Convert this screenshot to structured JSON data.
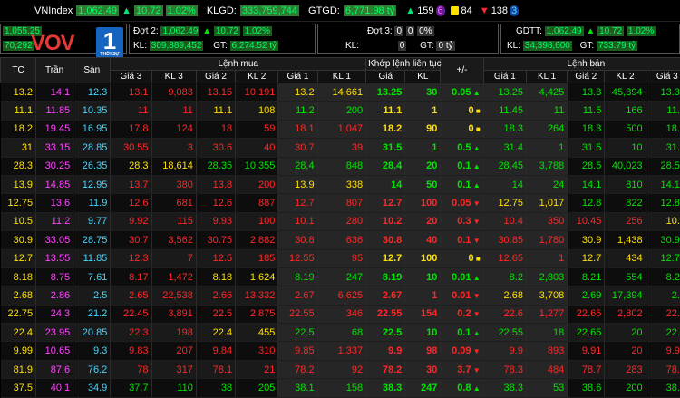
{
  "topbar": {
    "index_name": "VNIndex",
    "index_value": "1,062.49",
    "index_change": "10.72",
    "index_pct": "1.02%",
    "klgd_label": "KLGD:",
    "klgd_value": "333,759,744",
    "gtgd_label": "GTGD:",
    "gtgd_value": "6,771.98 tỷ",
    "up_count": "159",
    "up_ceiling": "6",
    "ref_count": "84",
    "down_count": "138",
    "down_floor": "3"
  },
  "boxes": {
    "left_r1": "1,055.25",
    "left_r2": "70,292",
    "b1_r1_label": "Đợt 2:",
    "b1_r1_value": "1,062.49",
    "b1_r1_change": "10.72",
    "b1_r1_pct": "1.02%",
    "b1_r2_kl_label": "KL:",
    "b1_r2_kl_value": "309,889,452",
    "b1_r2_gt_label": "GT:",
    "b1_r2_gt_value": "6,274.52 tỷ",
    "b2_r1_label": "Đợt 3:",
    "b2_r1_value": "0",
    "b2_r1_change": "0",
    "b2_r1_pct": "0%",
    "b2_r2_kl_label": "KL:",
    "b2_r2_kl_value": "0",
    "b2_r2_gt_label": "GT:",
    "b2_r2_gt_value": "0 tỷ",
    "b3_r1_label": "GDTT:",
    "b3_r1_value": "1,062.49",
    "b3_r1_change": "10.72",
    "b3_r1_pct": "1.02%",
    "b3_r2_kl_label": "KL:",
    "b3_r2_kl_value": "34,398,600",
    "b3_r2_gt_label": "GT:",
    "b3_r2_gt_value": "733.79 tỷ"
  },
  "logo": {
    "brand": "VOV",
    "channel": "1",
    "tagline": "THỜI SỰ"
  },
  "headers": {
    "tc": "TC",
    "tran": "Trần",
    "san": "Sàn",
    "lenh_mua": "Lệnh mua",
    "khop_lenh": "Khớp lệnh liên tục",
    "plusminus": "+/-",
    "lenh_ban": "Lệnh bán",
    "gia3": "Giá 3",
    "kl3": "KL 3",
    "gia2": "Giá 2",
    "kl2": "KL 2",
    "gia1": "Giá 1",
    "kl1": "KL 1",
    "gia": "Giá",
    "kl": "KL",
    "sgia1": "Giá 1",
    "skl1": "KL 1",
    "sgia2": "Giá 2",
    "skl2": "KL 2",
    "sgia3": "Giá 3"
  },
  "rows": [
    {
      "tc": "13.2",
      "tran": "14.1",
      "san": "12.3",
      "b3": "13.1",
      "bk3": "9,083",
      "b2": "13.15",
      "bk2": "10,191",
      "b1": "13.2",
      "bk1": "14,661",
      "p": "13.25",
      "k": "30",
      "ch": "0.05",
      "s1": "13.25",
      "sk1": "4,425",
      "s2": "13.3",
      "sk2": "45,394",
      "s3": "13.35",
      "cb3": "dn",
      "cb2": "dn",
      "cb1": "ref",
      "cp": "up",
      "cs1": "up",
      "cs2": "up",
      "cs3": "up",
      "dir": "up"
    },
    {
      "tc": "11.1",
      "tran": "11.85",
      "san": "10.35",
      "b3": "11",
      "bk3": "11",
      "b2": "11.1",
      "bk2": "108",
      "b1": "11.2",
      "bk1": "200",
      "p": "11.1",
      "k": "1",
      "ch": "0",
      "s1": "11.45",
      "sk1": "11",
      "s2": "11.5",
      "sk2": "166",
      "s3": "11.6",
      "cb3": "dn",
      "cb2": "ref",
      "cb1": "up",
      "cp": "ref",
      "cs1": "up",
      "cs2": "up",
      "cs3": "up",
      "dir": "eq"
    },
    {
      "tc": "18.2",
      "tran": "19.45",
      "san": "16.95",
      "b3": "17.8",
      "bk3": "124",
      "b2": "18",
      "bk2": "59",
      "b1": "18.1",
      "bk1": "1,047",
      "p": "18.2",
      "k": "90",
      "ch": "0",
      "s1": "18.3",
      "sk1": "264",
      "s2": "18.3",
      "sk2": "500",
      "s3": "18.4",
      "cb3": "dn",
      "cb2": "dn",
      "cb1": "dn",
      "cp": "ref",
      "cs1": "up",
      "cs2": "up",
      "cs3": "up",
      "dir": "eq"
    },
    {
      "tc": "31",
      "tran": "33.15",
      "san": "28.85",
      "b3": "30.55",
      "bk3": "3",
      "b2": "30.6",
      "bk2": "40",
      "b1": "30.7",
      "bk1": "39",
      "p": "31.5",
      "k": "1",
      "ch": "0.5",
      "s1": "31.4",
      "sk1": "1",
      "s2": "31.5",
      "sk2": "10",
      "s3": "31.8",
      "cb3": "dn",
      "cb2": "dn",
      "cb1": "dn",
      "cp": "up",
      "cs1": "up",
      "cs2": "up",
      "cs3": "up",
      "dir": "up"
    },
    {
      "tc": "28.3",
      "tran": "30.25",
      "san": "26.35",
      "b3": "28.3",
      "bk3": "18,614",
      "b2": "28.35",
      "bk2": "10,355",
      "b1": "28.4",
      "bk1": "848",
      "p": "28.4",
      "k": "20",
      "ch": "0.1",
      "s1": "28.45",
      "sk1": "3,788",
      "s2": "28.5",
      "sk2": "40,023",
      "s3": "28.55",
      "cb3": "ref",
      "cb2": "up",
      "cb1": "up",
      "cp": "up",
      "cs1": "up",
      "cs2": "up",
      "cs3": "up",
      "dir": "up"
    },
    {
      "tc": "13.9",
      "tran": "14.85",
      "san": "12.95",
      "b3": "13.7",
      "bk3": "380",
      "b2": "13.8",
      "bk2": "200",
      "b1": "13.9",
      "bk1": "338",
      "p": "14",
      "k": "50",
      "ch": "0.1",
      "s1": "14",
      "sk1": "24",
      "s2": "14.1",
      "sk2": "810",
      "s3": "14.15",
      "cb3": "dn",
      "cb2": "dn",
      "cb1": "ref",
      "cp": "up",
      "cs1": "up",
      "cs2": "up",
      "cs3": "up",
      "dir": "up"
    },
    {
      "tc": "12.75",
      "tran": "13.6",
      "san": "11.9",
      "b3": "12.6",
      "bk3": "681",
      "b2": "12.6",
      "bk2": "887",
      "b1": "12.7",
      "bk1": "807",
      "p": "12.7",
      "k": "100",
      "ch": "0.05",
      "s1": "12.75",
      "sk1": "1,017",
      "s2": "12.8",
      "sk2": "822",
      "s3": "12.85",
      "cb3": "dn",
      "cb2": "dn",
      "cb1": "dn",
      "cp": "dn",
      "cs1": "ref",
      "cs2": "up",
      "cs3": "up",
      "dir": "dn"
    },
    {
      "tc": "10.5",
      "tran": "11.2",
      "san": "9.77",
      "b3": "9.92",
      "bk3": "115",
      "b2": "9.93",
      "bk2": "100",
      "b1": "10.1",
      "bk1": "280",
      "p": "10.2",
      "k": "20",
      "ch": "0.3",
      "s1": "10.4",
      "sk1": "350",
      "s2": "10.45",
      "sk2": "256",
      "s3": "10.5",
      "cb3": "dn",
      "cb2": "dn",
      "cb1": "dn",
      "cp": "dn",
      "cs1": "dn",
      "cs2": "dn",
      "cs3": "ref",
      "dir": "dn"
    },
    {
      "tc": "30.9",
      "tran": "33.05",
      "san": "28.75",
      "b3": "30.7",
      "bk3": "3,562",
      "b2": "30.75",
      "bk2": "2,882",
      "b1": "30.8",
      "bk1": "636",
      "p": "30.8",
      "k": "40",
      "ch": "0.1",
      "s1": "30.85",
      "sk1": "1,780",
      "s2": "30.9",
      "sk2": "1,438",
      "s3": "30.95",
      "cb3": "dn",
      "cb2": "dn",
      "cb1": "dn",
      "cp": "dn",
      "cs1": "dn",
      "cs2": "ref",
      "cs3": "up",
      "dir": "dn"
    },
    {
      "tc": "12.7",
      "tran": "13.55",
      "san": "11.85",
      "b3": "12.3",
      "bk3": "7",
      "b2": "12.5",
      "bk2": "185",
      "b1": "12.55",
      "bk1": "95",
      "p": "12.7",
      "k": "100",
      "ch": "0",
      "s1": "12.65",
      "sk1": "1",
      "s2": "12.7",
      "sk2": "434",
      "s3": "12.75",
      "cb3": "dn",
      "cb2": "dn",
      "cb1": "dn",
      "cp": "ref",
      "cs1": "dn",
      "cs2": "ref",
      "cs3": "up",
      "dir": "eq"
    },
    {
      "tc": "8.18",
      "tran": "8.75",
      "san": "7.61",
      "b3": "8.17",
      "bk3": "1,472",
      "b2": "8.18",
      "bk2": "1,624",
      "b1": "8.19",
      "bk1": "247",
      "p": "8.19",
      "k": "10",
      "ch": "0.01",
      "s1": "8.2",
      "sk1": "2,803",
      "s2": "8.21",
      "sk2": "554",
      "s3": "8.22",
      "cb3": "dn",
      "cb2": "ref",
      "cb1": "up",
      "cp": "up",
      "cs1": "up",
      "cs2": "up",
      "cs3": "up",
      "dir": "up"
    },
    {
      "tc": "2.68",
      "tran": "2.86",
      "san": "2.5",
      "b3": "2.65",
      "bk3": "22,538",
      "b2": "2.66",
      "bk2": "13,332",
      "b1": "2.67",
      "bk1": "6,625",
      "p": "2.67",
      "k": "1",
      "ch": "0.01",
      "s1": "2.68",
      "sk1": "3,708",
      "s2": "2.69",
      "sk2": "17,394",
      "s3": "2.7",
      "cb3": "dn",
      "cb2": "dn",
      "cb1": "dn",
      "cp": "dn",
      "cs1": "ref",
      "cs2": "up",
      "cs3": "up",
      "dir": "dn"
    },
    {
      "tc": "22.75",
      "tran": "24.3",
      "san": "21.2",
      "b3": "22.45",
      "bk3": "3,891",
      "b2": "22.5",
      "bk2": "2,875",
      "b1": "22.55",
      "bk1": "346",
      "p": "22.55",
      "k": "154",
      "ch": "0.2",
      "s1": "22.6",
      "sk1": "1,277",
      "s2": "22.65",
      "sk2": "2,802",
      "s3": "22.7",
      "cb3": "dn",
      "cb2": "dn",
      "cb1": "dn",
      "cp": "dn",
      "cs1": "dn",
      "cs2": "dn",
      "cs3": "dn",
      "dir": "dn"
    },
    {
      "tc": "22.4",
      "tran": "23.95",
      "san": "20.85",
      "b3": "22.3",
      "bk3": "198",
      "b2": "22.4",
      "bk2": "455",
      "b1": "22.5",
      "bk1": "68",
      "p": "22.5",
      "k": "10",
      "ch": "0.1",
      "s1": "22.55",
      "sk1": "18",
      "s2": "22.65",
      "sk2": "20",
      "s3": "22.7",
      "cb3": "dn",
      "cb2": "ref",
      "cb1": "up",
      "cp": "up",
      "cs1": "up",
      "cs2": "up",
      "cs3": "up",
      "dir": "up"
    },
    {
      "tc": "9.99",
      "tran": "10.65",
      "san": "9.3",
      "b3": "9.83",
      "bk3": "207",
      "b2": "9.84",
      "bk2": "310",
      "b1": "9.85",
      "bk1": "1,337",
      "p": "9.9",
      "k": "98",
      "ch": "0.09",
      "s1": "9.9",
      "sk1": "893",
      "s2": "9.91",
      "sk2": "20",
      "s3": "9.92",
      "cb3": "dn",
      "cb2": "dn",
      "cb1": "dn",
      "cp": "dn",
      "cs1": "dn",
      "cs2": "dn",
      "cs3": "dn",
      "dir": "dn"
    },
    {
      "tc": "81.9",
      "tran": "87.6",
      "san": "76.2",
      "b3": "78",
      "bk3": "317",
      "b2": "78.1",
      "bk2": "21",
      "b1": "78.2",
      "bk1": "92",
      "p": "78.2",
      "k": "30",
      "ch": "3.7",
      "s1": "78.3",
      "sk1": "484",
      "s2": "78.7",
      "sk2": "283",
      "s3": "78.8",
      "cb3": "dn",
      "cb2": "dn",
      "cb1": "dn",
      "cp": "dn",
      "cs1": "dn",
      "cs2": "dn",
      "cs3": "dn",
      "dir": "dn"
    },
    {
      "tc": "37.5",
      "tran": "40.1",
      "san": "34.9",
      "b3": "37.7",
      "bk3": "110",
      "b2": "38",
      "bk2": "205",
      "b1": "38.1",
      "bk1": "158",
      "p": "38.3",
      "k": "247",
      "ch": "0.8",
      "s1": "38.3",
      "sk1": "53",
      "s2": "38.6",
      "sk2": "200",
      "s3": "38.7",
      "cb3": "up",
      "cb2": "up",
      "cb1": "up",
      "cp": "up",
      "cs1": "up",
      "cs2": "up",
      "cs3": "up",
      "dir": "up"
    }
  ]
}
